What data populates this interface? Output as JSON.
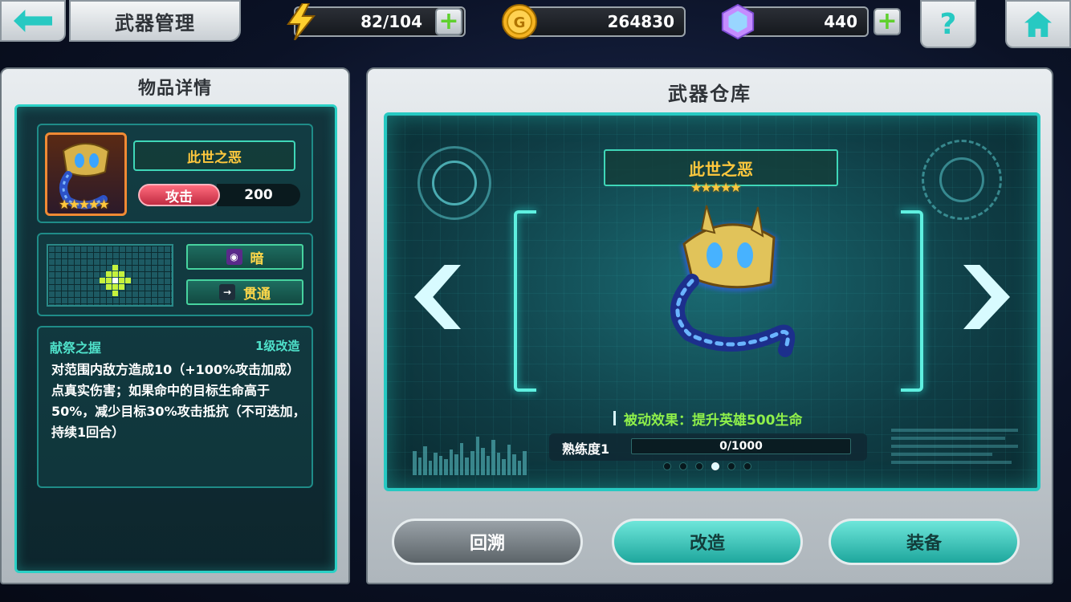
{
  "header": {
    "title": "武器管理",
    "energy": "82/104",
    "gold": "264830",
    "gems": "440",
    "help": "?"
  },
  "item_detail": {
    "panel_title": "物品详情",
    "weapon_name": "此世之恶",
    "stars": "★★★★★",
    "stat_label": "攻击",
    "stat_value": "200",
    "element_tag": "暗",
    "type_tag": "贯通",
    "skill_name": "献祭之握",
    "skill_level": "1级改造",
    "skill_desc": "对范围内敌方造成10（+100%攻击加成）点真实伤害；如果命中的目标生命高于50%，减少目标30%攻击抵抗（不可迭加，持续1回合）"
  },
  "warehouse": {
    "panel_title": "武器仓库",
    "weapon_name": "此世之恶",
    "stars": "★★★★★",
    "passive": "被动效果：提升英雄500生命",
    "proficiency_label": "熟练度1",
    "proficiency_text": "0/1000",
    "proficiency_fraction": 0,
    "page_count": 6,
    "active_page": 4
  },
  "actions": {
    "back": "回溯",
    "refine": "改造",
    "equip": "装备"
  },
  "colors": {
    "accent": "#27c9c2",
    "gold_text": "#ffc83d",
    "passive_text": "#8ff04a",
    "attack_badge": "#c12c42"
  },
  "icons": {
    "back": "back-arrow-icon",
    "energy": "lightning-icon",
    "gold": "gold-coin-icon",
    "gems": "gem-icon",
    "add": "plus-icon",
    "help": "question-icon",
    "home": "home-icon"
  }
}
